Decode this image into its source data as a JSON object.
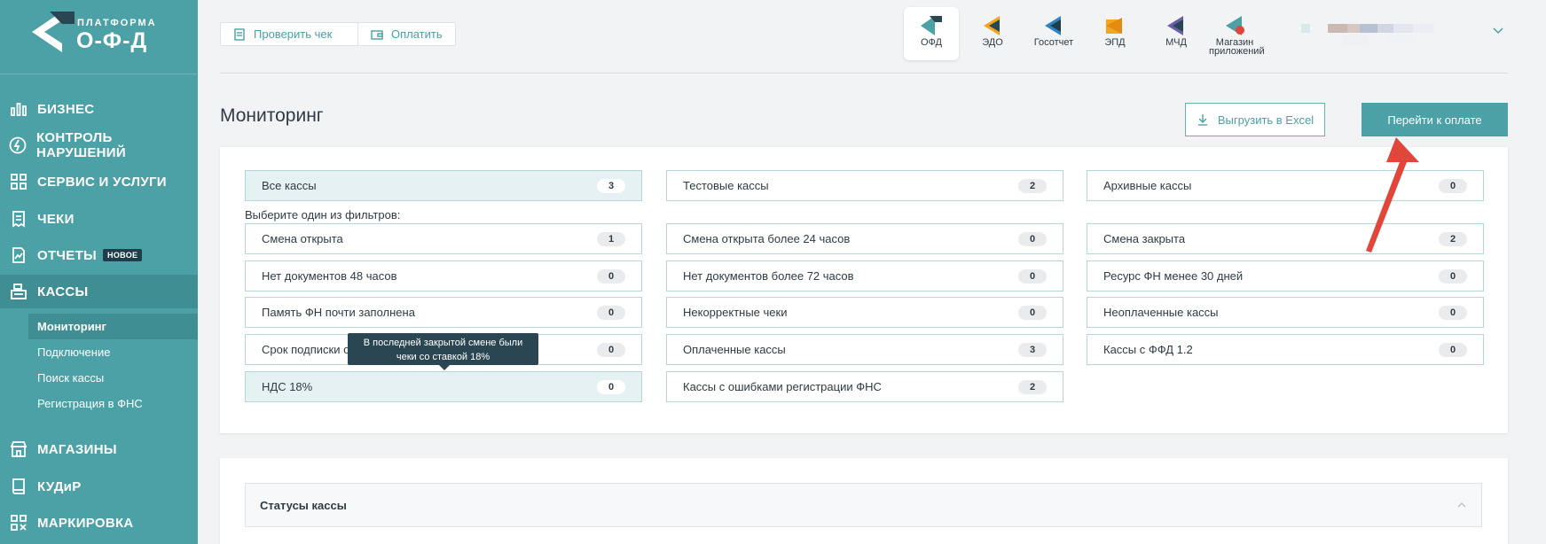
{
  "logo": {
    "small": "ПЛАТФОРМА",
    "big": "О-Ф-Д"
  },
  "sidebar": {
    "items": [
      {
        "label": "БИЗНЕС",
        "icon": "bar-chart-icon"
      },
      {
        "label": "КОНТРОЛЬ НАРУШЕНИЙ",
        "icon": "lightning-icon"
      },
      {
        "label": "СЕРВИС И УСЛУГИ",
        "icon": "grid-icon"
      },
      {
        "label": "ЧЕКИ",
        "icon": "receipt-icon"
      },
      {
        "label": "ОТЧЕТЫ",
        "icon": "report-icon",
        "badge": "НОВОЕ"
      },
      {
        "label": "КАССЫ",
        "icon": "cash-register-icon",
        "active": true
      },
      {
        "label": "МАГАЗИНЫ",
        "icon": "store-icon"
      },
      {
        "label": "КУДиР",
        "icon": "book-icon"
      },
      {
        "label": "МАРКИРОВКА",
        "icon": "qr-code-icon"
      }
    ],
    "subitems": [
      {
        "label": "Мониторинг",
        "active": true
      },
      {
        "label": "Подключение"
      },
      {
        "label": "Поиск кассы"
      },
      {
        "label": "Регистрация в ФНС"
      }
    ]
  },
  "header": {
    "check_button": "Проверить чек",
    "pay_button": "Оплатить",
    "apps": [
      {
        "label": "ОФД",
        "active": true
      },
      {
        "label": "ЭДО"
      },
      {
        "label": "Госотчет"
      },
      {
        "label": "ЭПД"
      },
      {
        "label": "МЧД"
      },
      {
        "label": "Магазин приложений"
      }
    ]
  },
  "page": {
    "title": "Мониторинг",
    "export_button": "Выгрузить в Excel",
    "go_pay_button": "Перейти к оплате"
  },
  "filters": {
    "hint": "Выберите один из фильтров:",
    "top": [
      {
        "label": "Все кассы",
        "count": "3",
        "selected": true
      },
      {
        "label": "Тестовые кассы",
        "count": "2"
      },
      {
        "label": "Архивные кассы",
        "count": "0"
      }
    ],
    "rows": [
      [
        {
          "label": "Смена открыта",
          "count": "1"
        },
        {
          "label": "Смена открыта более 24 часов",
          "count": "0"
        },
        {
          "label": "Смена закрыта",
          "count": "2"
        }
      ],
      [
        {
          "label": "Нет документов 48 часов",
          "count": "0"
        },
        {
          "label": "Нет документов более 72 часов",
          "count": "0"
        },
        {
          "label": "Ресурс ФН менее 30 дней",
          "count": "0"
        }
      ],
      [
        {
          "label": "Память ФН почти заполнена",
          "count": "0"
        },
        {
          "label": "Некорректные чеки",
          "count": "0"
        },
        {
          "label": "Неоплаченные кассы",
          "count": "0"
        }
      ],
      [
        {
          "label": "Срок подписки о",
          "count": "0"
        },
        {
          "label": "Оплаченные кассы",
          "count": "3"
        },
        {
          "label": "Кассы с ФФД 1.2",
          "count": "0"
        }
      ],
      [
        {
          "label": "НДС 18%",
          "count": "0",
          "selected": true
        },
        {
          "label": "Кассы с ошибками регистрации ФНС",
          "count": "2"
        }
      ]
    ],
    "tooltip_line1": "В последней закрытой смене были",
    "tooltip_line2": "чеки со ставкой 18%"
  },
  "status_section": {
    "title": "Статусы кассы"
  },
  "colors": {
    "accent": "#4ba1a6",
    "sidebar_active": "#3f8e93",
    "annotation_arrow": "#e0463a"
  }
}
